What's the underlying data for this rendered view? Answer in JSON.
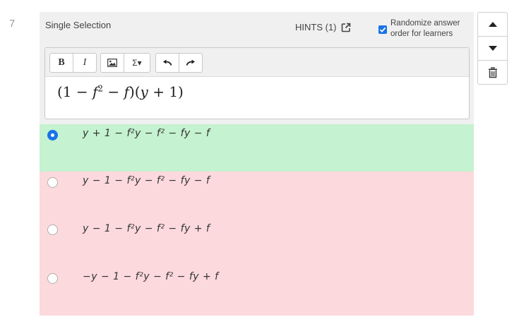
{
  "question": {
    "number": "7",
    "type_label": "Single Selection",
    "hints_label": "HINTS (1)",
    "randomize": {
      "checked": true,
      "label_line1": "Randomize answer",
      "label_line2": "order for learners"
    }
  },
  "side_controls": {
    "items": [
      "move-up-icon",
      "move-down-icon",
      "trash-icon"
    ]
  },
  "editor": {
    "toolbar": {
      "bold": "B",
      "italic": "I",
      "image": "image-icon",
      "equation": "Σ▾",
      "undo": "undo-icon",
      "redo": "redo-icon"
    },
    "content": {
      "p1": "(1 − ",
      "f1": "f",
      "exp": "2",
      "p2": " − ",
      "f2": "f",
      "p3": ")(",
      "y": "y",
      "p4": " + 1)"
    }
  },
  "answers": [
    {
      "status": "correct",
      "selected": true,
      "text": "y + 1 − f²y − f² − fy − f"
    },
    {
      "status": "incorrect",
      "selected": false,
      "text": "y − 1 − f²y − f² − fy − f"
    },
    {
      "status": "incorrect",
      "selected": false,
      "text": "y − 1 − f²y − f² − fy + f"
    },
    {
      "status": "incorrect",
      "selected": false,
      "text": "−y − 1 − f²y − f² − fy + f"
    }
  ],
  "colors": {
    "correct_bg": "#c5f2d0",
    "incorrect_bg": "#fcd9dc",
    "accent": "#1a73e8",
    "panel_bg": "#f0f0f0"
  }
}
